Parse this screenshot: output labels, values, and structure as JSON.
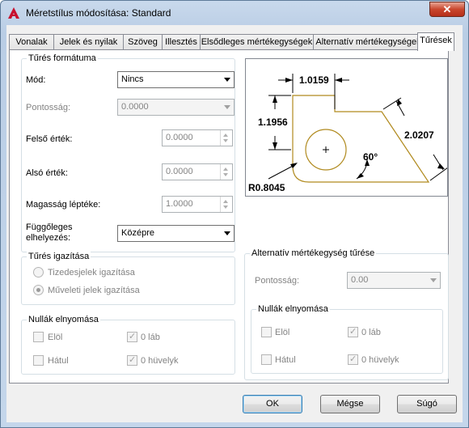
{
  "window": {
    "title": "Méretstílus módosítása: Standard",
    "close_glyph": "✕"
  },
  "tabs": [
    "Vonalak",
    "Jelek és nyilak",
    "Szöveg",
    "Illesztés",
    "Elsődleges mértékegységek",
    "Alternatív mértékegységek",
    "Tűrések"
  ],
  "tolerance_format": {
    "title": "Tűrés formátuma",
    "mode_label": "Mód:",
    "mode_value": "Nincs",
    "precision_label": "Pontosság:",
    "precision_value": "0.0000",
    "upper_label": "Felső érték:",
    "upper_value": "0.0000",
    "lower_label": "Alsó érték:",
    "lower_value": "0.0000",
    "height_label": "Magasság léptéke:",
    "height_value": "1.0000",
    "vpos_label_1": "Függőleges",
    "vpos_label_2": "elhelyezés:",
    "vpos_value": "Középre"
  },
  "alignment": {
    "title": "Tűrés igazítása",
    "opt1": "Tizedesjelek igazítása",
    "opt2": "Műveleti jelek igazítása",
    "selected": "Műveleti jelek igazítása"
  },
  "zero_suppression": {
    "title": "Nullák elnyomása",
    "leading": "Elöl",
    "trailing": "Hátul",
    "zero_feet": "0 láb",
    "zero_inches": "0 hüvelyk",
    "leading_checked": false,
    "trailing_checked": false,
    "feet_checked": true,
    "inches_checked": true
  },
  "alt_tolerance": {
    "title": "Alternatív mértékegység tűrése",
    "precision_label": "Pontosság:",
    "precision_value": "0.00",
    "zs_title": "Nullák elnyomása",
    "leading": "Elöl",
    "trailing": "Hátul",
    "zero_feet": "0 láb",
    "zero_inches": "0 hüvelyk",
    "leading_checked": false,
    "trailing_checked": false,
    "feet_checked": true,
    "inches_checked": true
  },
  "preview": {
    "dim_top": "1.0159",
    "dim_left": "1.1956",
    "dim_right": "2.0207",
    "dim_angle": "60°",
    "dim_radius": "R0.8045"
  },
  "buttons": {
    "ok": "OK",
    "cancel": "Mégse",
    "help": "Súgó"
  },
  "colors": {
    "accent": "#3c7fb1",
    "shape_stroke": "#b08a1e",
    "app_icon": "#c8102e"
  }
}
